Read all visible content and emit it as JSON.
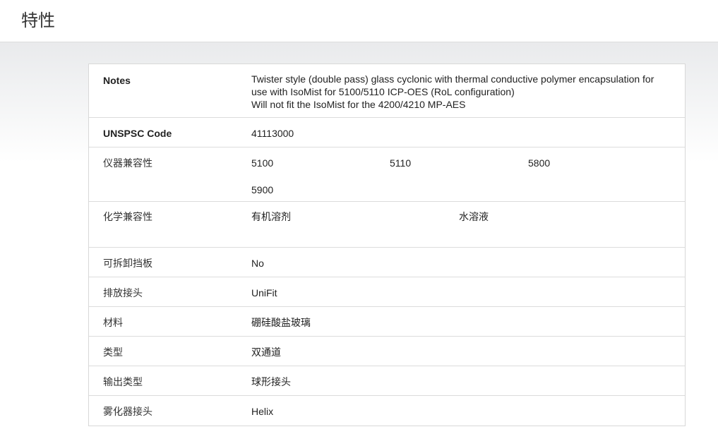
{
  "header": {
    "title": "特性"
  },
  "specs": {
    "notes": {
      "label": "Notes",
      "lines": [
        "Twister style (double pass) glass cyclonic with thermal conductive polymer encapsulation for",
        "use with IsoMist for 5100/5110 ICP-OES (RoL configuration)",
        "Will not fit the IsoMist for the 4200/4210 MP-AES"
      ]
    },
    "unspsc": {
      "label": "UNSPSC Code",
      "value": "41113000"
    },
    "instrument": {
      "label": "仪器兼容性",
      "values": [
        "5100",
        "5110",
        "5800",
        "5900"
      ]
    },
    "chemical": {
      "label": "化学兼容性",
      "values": [
        "有机溶剂",
        "水溶液"
      ]
    },
    "baffle": {
      "label": "可拆卸挡板",
      "value": "No"
    },
    "drain": {
      "label": "排放接头",
      "value": "UniFit"
    },
    "material": {
      "label": "材料",
      "value": "硼硅酸盐玻璃"
    },
    "type": {
      "label": "类型",
      "value": "双通道"
    },
    "output": {
      "label": "输出类型",
      "value": "球形接头"
    },
    "nebulizer": {
      "label": "雾化器接头",
      "value": "Helix"
    }
  }
}
